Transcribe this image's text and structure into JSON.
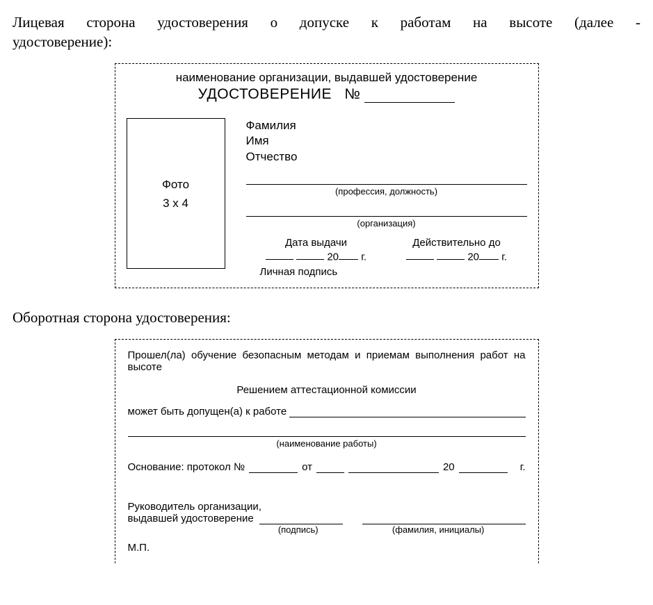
{
  "intro_line1": "Лицевая сторона удостоверения о допуске к работам на высоте (далее -",
  "intro_line2": "удостоверение):",
  "section2_title": "Оборотная сторона удостоверения:",
  "front": {
    "org_placeholder": "наименование организации, выдавшей удостоверение",
    "cert_word": "УДОСТОВЕРЕНИЕ",
    "number_prefix": "№",
    "photo_label": "Фото",
    "photo_size": "3 x 4",
    "surname": "Фамилия",
    "name": "Имя",
    "patronymic": "Отчество",
    "profession_caption": "(профессия, должность)",
    "org_caption": "(организация)",
    "date_issue": "Дата выдачи",
    "valid_until": "Действительно до",
    "date_fmt_mid": "20",
    "date_fmt_suffix": "г.",
    "signature": "Личная подпись"
  },
  "back": {
    "line1": "Прошел(ла) обучение безопасным методам и приемам выполнения работ на",
    "line2": "высоте",
    "decision": "Решением аттестационной комиссии",
    "admitted": "может быть допущен(а) к работе",
    "work_caption": "(наименование работы)",
    "basis": "Основание: протокол №",
    "from": "от",
    "year_mid": "20",
    "year_suffix": "г.",
    "head1": "Руководитель организации,",
    "head2": "выдавшей удостоверение",
    "sig_caption": "(подпись)",
    "fio_caption": "(фамилия, инициалы)",
    "mp": "М.П."
  }
}
